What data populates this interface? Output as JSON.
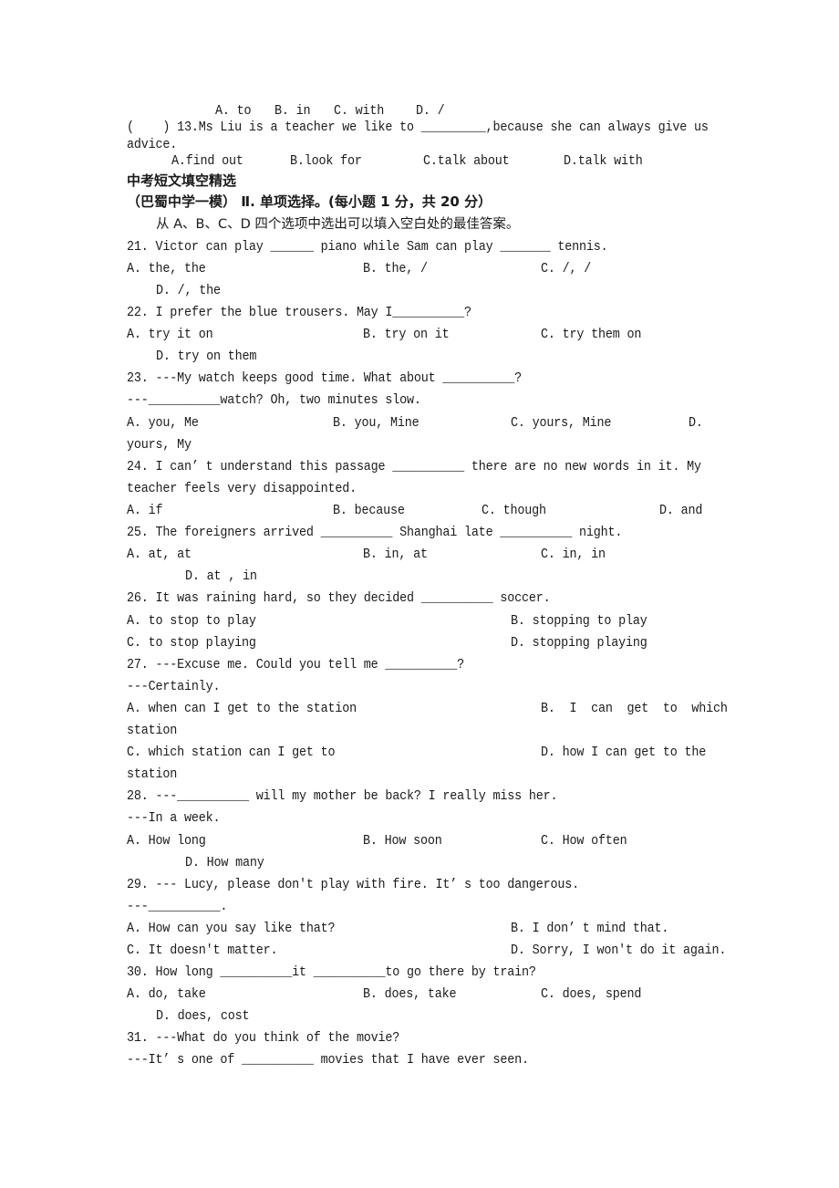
{
  "q12_options": {
    "a": "A. to",
    "b": "B. in",
    "c": "C. with",
    "d": "D. /"
  },
  "q13": {
    "line1": "(    ) 13.Ms Liu is a teacher we like to _________,because she can always give us",
    "line2": "advice.",
    "options": {
      "a": "A.find out",
      "b": "B.look for",
      "c": "C.talk about",
      "d": "D.talk with"
    }
  },
  "section_heading": "中考短文填空精选",
  "part_heading": "（巴蜀中学一模） Ⅱ. 单项选择。(每小题 1 分，共 20 分）",
  "instruction": "从 A、B、C、D 四个选项中选出可以填入空白处的最佳答案。",
  "questions": {
    "q21": {
      "stem": "21. Victor can play ______ piano while Sam can play _______ tennis.",
      "a": "A. the, the",
      "b": "B. the, /",
      "c": "C. /, /",
      "d": "D. /, the"
    },
    "q22": {
      "stem": "22. I prefer the blue trousers. May I__________?",
      "a": "A. try it on",
      "b": "B. try on it",
      "c": "C. try them on",
      "d": "D. try on them"
    },
    "q23": {
      "stem": "23. ---My watch keeps good time. What about __________?",
      "stem2": "---__________watch? Oh, two minutes slow.",
      "a": "A. you, Me",
      "b": "B. you, Mine",
      "c": "C. yours, Mine",
      "d": "D.",
      "d2": "yours, My"
    },
    "q24": {
      "stem": "24. I can’ t understand this passage __________ there are no new words in it. My",
      "stem2": "teacher feels very disappointed.",
      "a": "A. if",
      "b": "B. because",
      "c": "C. though",
      "d": "D. and"
    },
    "q25": {
      "stem": "25. The foreigners arrived __________ Shanghai late __________ night.",
      "a": "A. at, at",
      "b": "B. in, at",
      "c": "C. in, in",
      "d": "D. at , in"
    },
    "q26": {
      "stem": "26. It was raining hard, so they decided __________ soccer.",
      "a": "A. to stop to play",
      "b": "B. stopping to play",
      "c": "C. to stop playing",
      "d": "D. stopping playing"
    },
    "q27": {
      "stem": "27. ---Excuse me. Could you tell me __________?",
      "stem2": "---Certainly.",
      "a": "A. when can I get to the station",
      "b": "B.  I  can  get  to  which",
      "b2": "station",
      "c": "C. which station can I get to",
      "d": "D. how I can get to the",
      "d2": "station"
    },
    "q28": {
      "stem": "28. ---__________ will my mother be back? I really miss her.",
      "stem2": "---In a week.",
      "a": "A. How long",
      "b": "B. How soon",
      "c": "C. How often",
      "d": "D. How many"
    },
    "q29": {
      "stem": "29. --- Lucy, please don't play with fire. It’ s too dangerous.",
      "stem2": "---__________.",
      "a": "A. How can you say like that?",
      "b": "B. I don’ t mind that.",
      "c": "C. It doesn't matter.",
      "d": "D. Sorry, I won't do it again."
    },
    "q30": {
      "stem": "30. How long __________it __________to go there by train?",
      "a": "A. do, take",
      "b": "B. does, take",
      "c": "C. does, spend",
      "d": "D. does, cost"
    },
    "q31": {
      "stem": "31. ---What do you think of the movie?",
      "stem2": "---It’ s one of __________ movies that I have ever seen."
    }
  }
}
